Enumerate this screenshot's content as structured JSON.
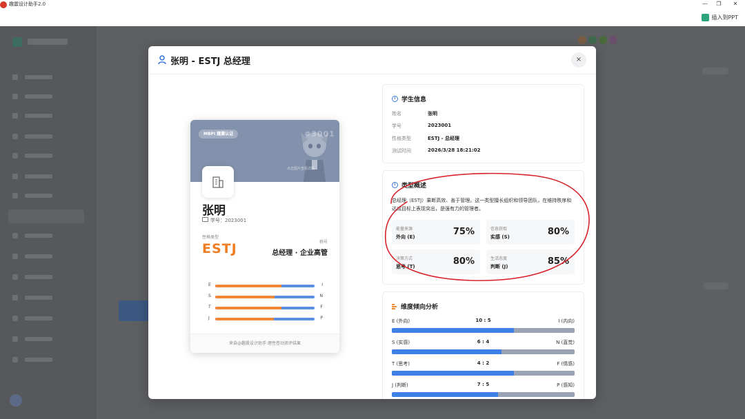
{
  "app": {
    "title": "趣震设计助手2.0",
    "insert_ppt": "插入到PPT"
  },
  "window_controls": {
    "minimize": "—",
    "restore": "❐",
    "close": "✕"
  },
  "modal": {
    "title": "张明 - ESTJ 总经理",
    "close": "×"
  },
  "card": {
    "badge": "MBPI 趣震认证",
    "number": "#3001",
    "hint": "点击图片查看详情",
    "name": "张明",
    "id_text": "学号：2023001",
    "type_label": "性格类型",
    "type_code": "ESTJ",
    "title_label": "称号",
    "title_value": "总经理 · 企业高管",
    "dimensions": [
      {
        "left": "E",
        "right": "I",
        "left_share": 0.67
      },
      {
        "left": "S",
        "right": "N",
        "left_share": 0.6
      },
      {
        "left": "T",
        "right": "F",
        "left_share": 0.67
      },
      {
        "left": "J",
        "right": "P",
        "left_share": 0.59
      }
    ],
    "footer": "来自@趣震设计助手·理性苍动测评结果"
  },
  "student_info": {
    "title": "学生信息",
    "rows": [
      {
        "key": "姓名",
        "value": "张明"
      },
      {
        "key": "学号",
        "value": "2023001"
      },
      {
        "key": "性格类型",
        "value": "ESTJ - 总经理"
      },
      {
        "key": "测试时间",
        "value": "2026/3/28 18:21:02"
      }
    ]
  },
  "overview": {
    "title": "类型概述",
    "text": "总经理（ESTJ）果断高效、善于管理。这一类型擅长组织和领导团队，在维持秩序和达成目标上表现突出，是强有力的管理者。",
    "stats": [
      {
        "label": "能量来源",
        "value": "外向 (E)",
        "percent": "75%"
      },
      {
        "label": "信息获取",
        "value": "实感 (S)",
        "percent": "80%"
      },
      {
        "label": "决策方式",
        "value": "思考 (T)",
        "percent": "80%"
      },
      {
        "label": "生活态度",
        "value": "判断 (J)",
        "percent": "85%"
      }
    ]
  },
  "analysis": {
    "title": "维度倾向分析",
    "rows": [
      {
        "left": "E (外向)",
        "ratio": "10 : 5",
        "right": "I (内向)",
        "left_share": 0.667
      },
      {
        "left": "S (实感)",
        "ratio": "6 : 4",
        "right": "N (直觉)",
        "left_share": 0.6
      },
      {
        "left": "T (思考)",
        "ratio": "4 : 2",
        "right": "F (情感)",
        "left_share": 0.667
      },
      {
        "left": "J (判断)",
        "ratio": "7 : 5",
        "right": "P (感知)",
        "left_share": 0.583
      }
    ]
  },
  "colors": {
    "accent_orange": "#f07d22",
    "bar_blue": "#3f80e6",
    "annotation_red": "#d6232a"
  }
}
